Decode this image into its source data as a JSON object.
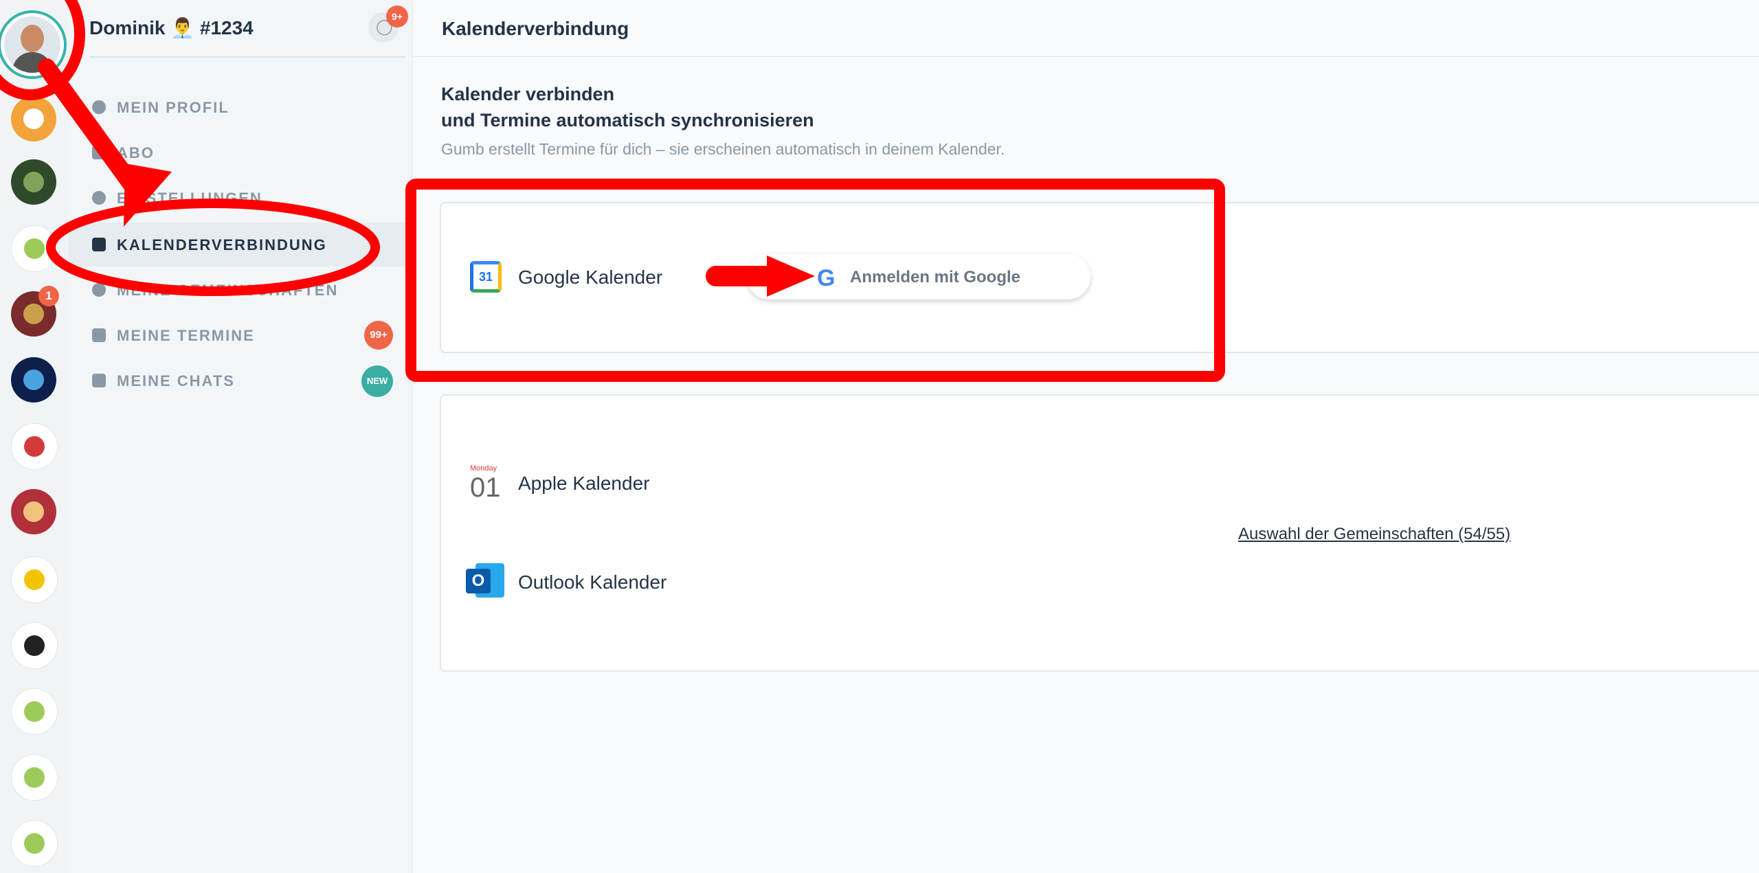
{
  "sidebar": {
    "user_name": "Dominik 👨‍💼 #1234",
    "notifications_badge": "9+",
    "items": [
      {
        "label": "MEIN PROFIL"
      },
      {
        "label": "ABO"
      },
      {
        "label": "EINSTELLUNGEN"
      },
      {
        "label": "KALENDERVERBINDUNG"
      },
      {
        "label": "MEINE GEMEINSCHAFTEN"
      },
      {
        "label": "MEINE TERMINE",
        "badge": "99+"
      },
      {
        "label": "MEINE CHATS",
        "badge": "NEW"
      }
    ]
  },
  "rail": {
    "unread_badge": "1"
  },
  "header": {
    "title": "Kalenderverbindung"
  },
  "main": {
    "heading_line1": "Kalender verbinden",
    "heading_line2": "und Termine automatisch synchronisieren",
    "subtitle": "Gumb erstellt Termine für dich – sie erscheinen automatisch in deinem Kalender.",
    "google": {
      "label": "Google Kalender",
      "icon_text": "31",
      "button_label": "Anmelden mit Google",
      "button_icon_text": "G"
    },
    "apple": {
      "label": "Apple Kalender",
      "icon_day": "Monday",
      "icon_number": "01"
    },
    "outlook": {
      "label": "Outlook Kalender",
      "icon_text": "O"
    },
    "communities_link": "Auswahl der Gemeinschaften (54/55)"
  },
  "colors": {
    "accent": "#3aaea3",
    "badge": "#f06548",
    "annotation": "#ff0000"
  }
}
